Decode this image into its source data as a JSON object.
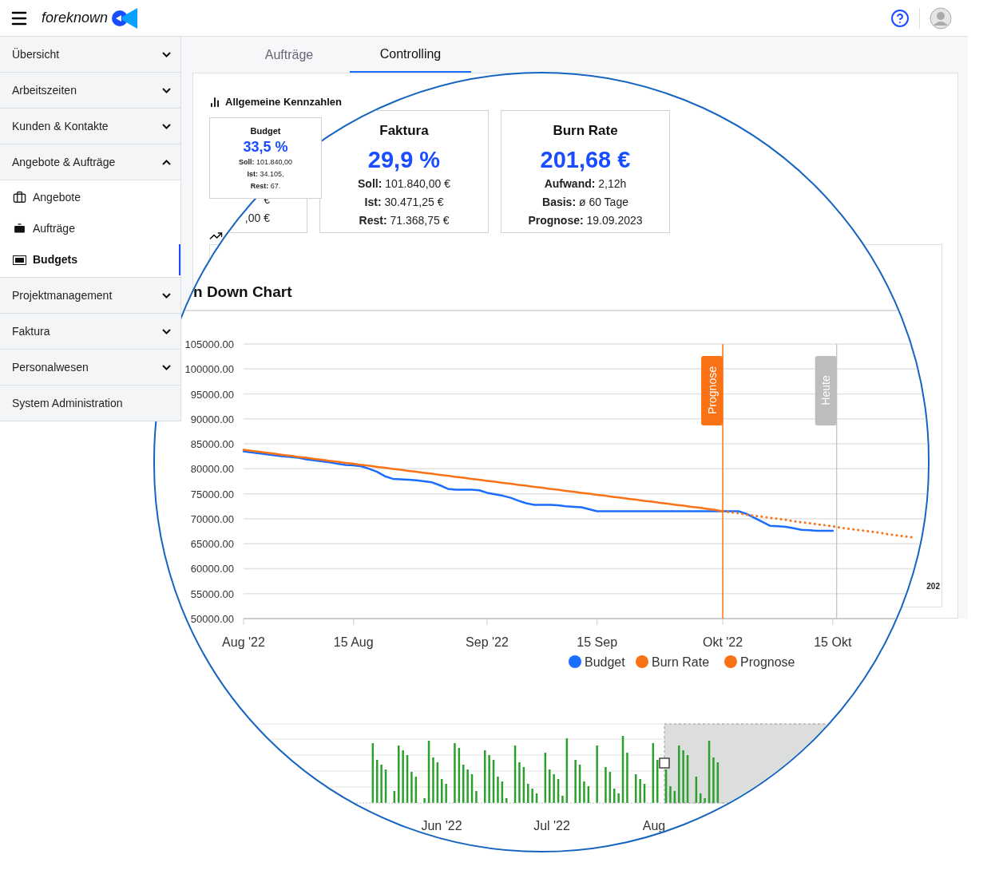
{
  "header": {
    "brand": "foreknown"
  },
  "sidebar": {
    "items": [
      {
        "label": "Übersicht",
        "expanded": false
      },
      {
        "label": "Arbeitszeiten",
        "expanded": false
      },
      {
        "label": "Kunden & Kontakte",
        "expanded": false
      },
      {
        "label": "Angebote & Aufträge",
        "expanded": true,
        "children": [
          {
            "label": "Angebote",
            "selected": false
          },
          {
            "label": "Aufträge",
            "selected": false
          },
          {
            "label": "Budgets",
            "selected": true
          }
        ]
      },
      {
        "label": "Projektmanagement",
        "expanded": false
      },
      {
        "label": "Faktura",
        "expanded": false
      },
      {
        "label": "Personalwesen",
        "expanded": false
      },
      {
        "label": "System Administration"
      }
    ]
  },
  "tabs": [
    {
      "label": "Aufträge",
      "selected": false
    },
    {
      "label": "Controlling",
      "selected": true
    }
  ],
  "kennzahlen": {
    "title": "Allgemeine Kennzahlen",
    "budget_card": {
      "title": "Budget",
      "value": "33,5 %",
      "lines": [
        {
          "label": "Soll:",
          "value": "101.840,00"
        },
        {
          "label": "Ist:",
          "value": "34.105,"
        },
        {
          "label": "Rest:",
          "value": "67."
        }
      ]
    }
  },
  "background_chart": {
    "label": "202"
  },
  "magnifier": {
    "budget_fragment": {
      "lines": [
        "€",
        ",00 €"
      ]
    },
    "cards": [
      {
        "title": "Faktura",
        "value": "29,9 %",
        "lines": [
          {
            "label": "Soll:",
            "value": "101.840,00 €"
          },
          {
            "label": "Ist:",
            "value": "30.471,25 €"
          },
          {
            "label": "Rest:",
            "value": "71.368,75 €"
          }
        ]
      },
      {
        "title": "Burn Rate",
        "value": "201,68 €",
        "lines": [
          {
            "label": "Aufwand:",
            "value": "2,12h"
          },
          {
            "label": "Basis:",
            "value": "ø 60 Tage"
          },
          {
            "label": "Prognose:",
            "value": "19.09.2023"
          }
        ]
      }
    ],
    "burn_down": {
      "title": "n Down Chart",
      "chart_data": {
        "type": "line",
        "categories": [
          "Aug '22",
          null,
          null,
          null,
          null,
          null,
          null,
          null,
          null,
          null,
          null,
          null,
          null,
          null,
          "15 Aug",
          null,
          null,
          null,
          null,
          null,
          null,
          null,
          null,
          null,
          null,
          null,
          null,
          null,
          null,
          null,
          null,
          "Sep '22",
          null,
          null,
          null,
          null,
          null,
          null,
          null,
          null,
          null,
          null,
          null,
          null,
          null,
          "15 Sep",
          null,
          null,
          null,
          null,
          null,
          null,
          null,
          null,
          null,
          null,
          null,
          null,
          null,
          null,
          null,
          "Okt '22",
          null,
          null,
          null,
          null,
          null,
          null,
          null,
          null,
          null,
          null,
          null,
          null,
          null,
          "15 Okt",
          null,
          null,
          null,
          null,
          null,
          null,
          null,
          null,
          null,
          null
        ],
        "series": [
          {
            "name": "Budget",
            "color": "#1a6dff",
            "values": [
              83500,
              83300,
              83100,
              82900,
              82700,
              82500,
              82400,
              82200,
              81900,
              81700,
              81500,
              81300,
              81000,
              80800,
              80700,
              80500,
              80000,
              79400,
              78500,
              78000,
              77900,
              77800,
              77700,
              77500,
              77300,
              76700,
              76000,
              75800,
              75800,
              75800,
              75700,
              75200,
              74900,
              74600,
              74200,
              73600,
              73100,
              72800,
              72800,
              72800,
              72700,
              72500,
              72400,
              72300,
              71900,
              71500,
              71500,
              71500,
              71500,
              71500,
              71500,
              71500,
              71500,
              71500,
              71500,
              71500,
              71500,
              71500,
              71500,
              71500,
              71500,
              71500,
              71500,
              71500,
              71000,
              70200,
              69400,
              68600,
              68500,
              68400,
              68100,
              67800,
              67700,
              67600,
              67600,
              67600,
              null,
              null,
              null,
              null,
              null,
              null,
              null,
              null,
              null,
              null
            ]
          },
          {
            "name": "Burn Rate",
            "color": "#f97316",
            "values": [
              83800,
              83600,
              83400,
              83200,
              83000,
              82800,
              82600,
              82400,
              82200,
              82000,
              81800,
              81600,
              81400,
              81200,
              81000,
              80800,
              80600,
              80400,
              80200,
              80000,
              79800,
              79600,
              79400,
              79200,
              79000,
              78800,
              78600,
              78400,
              78200,
              78000,
              77800,
              77600,
              77400,
              77200,
              77000,
              76800,
              76600,
              76400,
              76200,
              76000,
              75800,
              75600,
              75400,
              75200,
              75000,
              74800,
              74600,
              74400,
              74200,
              74000,
              73800,
              73600,
              73400,
              73200,
              73000,
              72800,
              72600,
              72400,
              72200,
              72000,
              71800,
              71500,
              null,
              null,
              null,
              null,
              null,
              null,
              null,
              null,
              null,
              null,
              null,
              null,
              null,
              null,
              null,
              null,
              null,
              null,
              null,
              null,
              null,
              null,
              null,
              null
            ]
          },
          {
            "name": "Prognose",
            "color": "#f97316",
            "line_style": "dotted",
            "values": [
              null,
              null,
              null,
              null,
              null,
              null,
              null,
              null,
              null,
              null,
              null,
              null,
              null,
              null,
              null,
              null,
              null,
              null,
              null,
              null,
              null,
              null,
              null,
              null,
              null,
              null,
              null,
              null,
              null,
              null,
              null,
              null,
              null,
              null,
              null,
              null,
              null,
              null,
              null,
              null,
              null,
              null,
              null,
              null,
              null,
              null,
              null,
              null,
              null,
              null,
              null,
              null,
              null,
              null,
              null,
              null,
              null,
              null,
              null,
              null,
              null,
              71500,
              71300,
              71100,
              70800,
              70600,
              70400,
              70200,
              70000,
              69800,
              69500,
              69300,
              69100,
              68900,
              68700,
              68500,
              68200,
              68000,
              67800,
              67600,
              67400,
              67200,
              66900,
              66700,
              66500,
              66300
            ]
          }
        ],
        "grid": true,
        "legend": "bottom",
        "ylim": [
          50000,
          105000
        ],
        "yticks": [
          {
            "value": 105000,
            "label": "105000.00"
          },
          {
            "value": 100000,
            "label": "100000.00"
          },
          {
            "value": 95000,
            "label": "95000.00"
          },
          {
            "value": 90000,
            "label": "90000.00"
          },
          {
            "value": 85000,
            "label": "85000.00"
          },
          {
            "value": 80000,
            "label": "80000.00"
          },
          {
            "value": 75000,
            "label": "75000.00"
          },
          {
            "value": 70000,
            "label": "70000.00"
          },
          {
            "value": 65000,
            "label": "65000.00"
          },
          {
            "value": 60000,
            "label": "60000.00"
          },
          {
            "value": 55000,
            "label": "55000.00"
          },
          {
            "value": 50000,
            "label": "50000.00"
          }
        ],
        "annotations": [
          "Prognose",
          "Heute"
        ]
      }
    },
    "navigator": {
      "labels": [
        "Jun '22",
        "Jul '22",
        "Aug"
      ]
    }
  }
}
